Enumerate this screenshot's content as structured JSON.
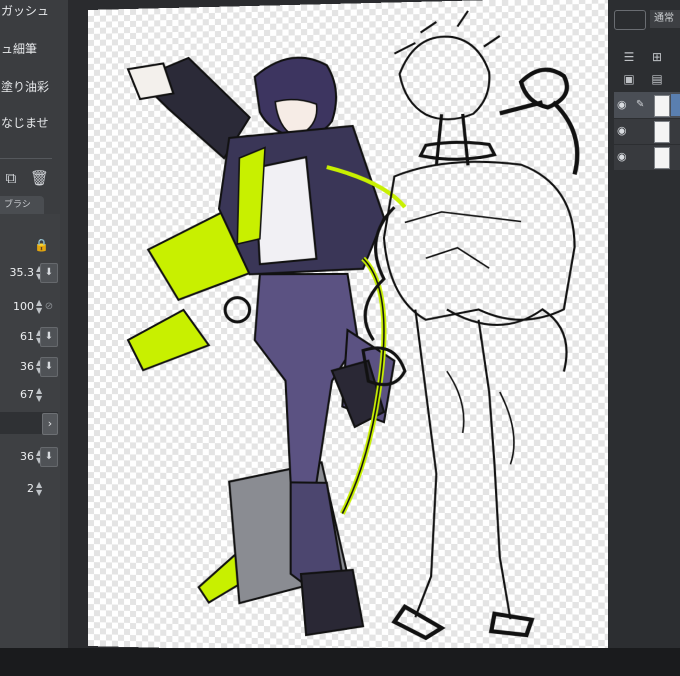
{
  "brushes": [
    {
      "label": "ガッシュ"
    },
    {
      "label": "ュ細筆"
    },
    {
      "label": "塗り油彩"
    },
    {
      "label": "なじませ"
    }
  ],
  "tool_icons": {
    "add": "add-layer-icon",
    "delete": "trash-icon"
  },
  "tool_property": {
    "tab_label": "ブラシ",
    "lock_icon": "lock-icon",
    "values": [
      {
        "value": "35.3",
        "button": "download-icon"
      },
      {
        "value": "100",
        "button": "reset-icon"
      },
      {
        "value": "61",
        "button": "download-icon"
      },
      {
        "value": "36",
        "button": "download-icon"
      },
      {
        "value": "67"
      },
      {
        "value": "36",
        "button": "download-icon"
      },
      {
        "value": "2"
      }
    ]
  },
  "layer_panel": {
    "blend_mode": "通常",
    "layers": [
      {
        "visible": true,
        "selected": true
      },
      {
        "visible": true,
        "selected": false
      },
      {
        "visible": true,
        "selected": false
      }
    ]
  },
  "canvas": {
    "colors": {
      "accent": "#c8f000",
      "purple": "#5b5282",
      "ink": "#111111"
    }
  }
}
